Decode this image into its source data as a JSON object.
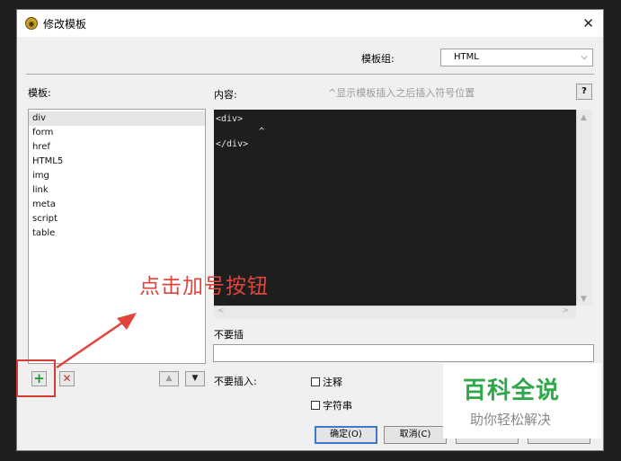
{
  "window": {
    "title": "修改模板",
    "close_glyph": "✕",
    "app_icon_glyph": "◉"
  },
  "group": {
    "label": "模板组:",
    "selected": "HTML",
    "arrow_glyph": "⌵"
  },
  "templates": {
    "label": "模板:",
    "items": [
      "div",
      "form",
      "href",
      "HTML5",
      "img",
      "link",
      "meta",
      "script",
      "table"
    ]
  },
  "content": {
    "label": "内容:",
    "hint": "^显示模板插入之后插入符号位置",
    "help_label": "?",
    "code": "<div>\n        ^\n</div>"
  },
  "scroll_arrows": {
    "up": "▲",
    "down": "▼",
    "left": "<",
    "right": ">"
  },
  "no_insert": {
    "label": "不要插",
    "options_label": "不要插入:",
    "option_comments": "注释",
    "option_strings": "字符串"
  },
  "list_buttons": {
    "add": "+",
    "delete": "✕",
    "up": "▲",
    "down": "▼"
  },
  "annotation": "点击加号按钮",
  "footer": {
    "ok": "确定(O)",
    "cancel": "取消(C)"
  },
  "watermark": {
    "title": "百科全说",
    "subtitle": "助你轻松解决"
  },
  "colors": {
    "accent_red": "#d83b33",
    "add_green": "#1f9a2c",
    "watermark_green": "#2fa74b",
    "editor_bg": "#1e1e1e"
  }
}
